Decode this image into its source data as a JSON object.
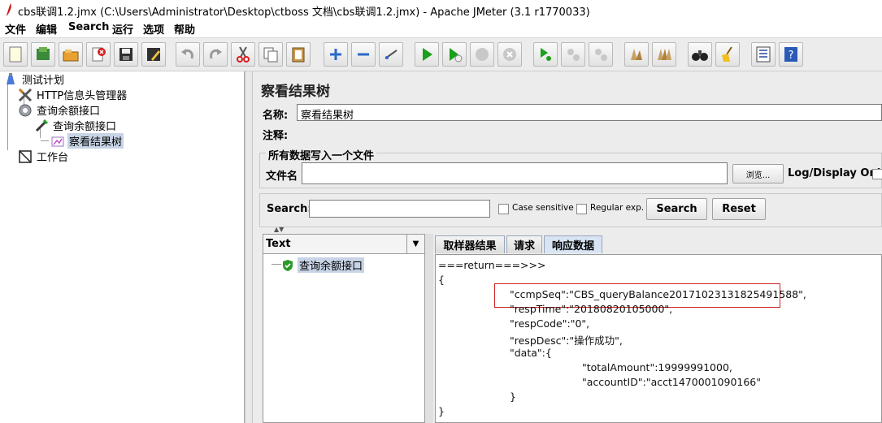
{
  "window": {
    "title": "cbs联调1.2.jmx (C:\\Users\\Administrator\\Desktop\\ctboss 文档\\cbs联调1.2.jmx) - Apache JMeter (3.1 r1770033)"
  },
  "menu": [
    "文件",
    "编辑",
    "Search",
    "运行",
    "选项",
    "帮助"
  ],
  "toolbar": {
    "icons": [
      "new-icon",
      "templates-icon",
      "open-icon",
      "close-icon",
      "save-icon",
      "save-as-icon",
      "undo-icon",
      "redo-icon",
      "cut-icon",
      "copy-icon",
      "paste-icon",
      "expand-icon",
      "collapse-icon",
      "toggle-icon",
      "start-icon",
      "start-no-pause-icon",
      "stop-icon",
      "shutdown-icon",
      "remote-start-icon",
      "remote-stop-icon",
      "remote-shutdown-icon",
      "clear-icon",
      "clear-all-icon",
      "search-icon",
      "reset-search-icon",
      "function-helper-icon",
      "help-icon"
    ]
  },
  "tree": {
    "items": [
      {
        "label": "测试计划",
        "icon": "test-plan-icon"
      },
      {
        "label": "HTTP信息头管理器",
        "icon": "header-manager-icon"
      },
      {
        "label": "查询余额接口",
        "icon": "thread-group-icon"
      },
      {
        "label": "查询余额接口",
        "icon": "sampler-icon"
      },
      {
        "label": "察看结果树",
        "icon": "listener-icon"
      },
      {
        "label": "工作台",
        "icon": "workbench-icon"
      }
    ]
  },
  "panel": {
    "title": "察看结果树",
    "name_label": "名称:",
    "name_value": "察看结果树",
    "comment_label": "注释:",
    "comment_value": "",
    "file_group_title": "所有数据写入一个文件",
    "filename_label": "文件名",
    "filename_value": "",
    "browse_label": "浏览...",
    "log_display_label": "Log/Display Only:"
  },
  "search": {
    "label": "Search:",
    "value": "",
    "case_sensitive_label": "Case sensitive",
    "regex_label": "Regular exp.",
    "search_button": "Search",
    "reset_button": "Reset"
  },
  "results": {
    "renderer": "Text",
    "tree_items": [
      {
        "label": "查询余额接口",
        "status": "success"
      }
    ],
    "tabs": [
      "取样器结果",
      "请求",
      "响应数据"
    ],
    "active_tab": "响应数据",
    "response_lines": [
      "===return===>>>",
      "{",
      "\"ccmpSeq\":\"CBS_queryBalance20171023131825491588\",",
      "\"respTime\":\"20180820105000\",",
      "\"respCode\":\"0\",",
      "\"respDesc\":\"操作成功\",",
      "\"data\":{",
      "\"totalAmount\":19999991000,",
      "\"accountID\":\"acct1470001090166\"",
      "}",
      "}"
    ],
    "highlight_color": "#d02020"
  }
}
